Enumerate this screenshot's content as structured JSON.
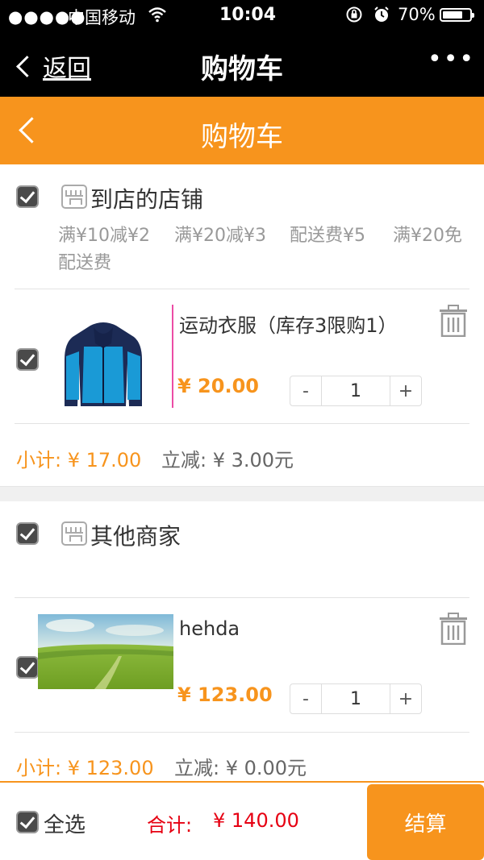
{
  "status_bar": {
    "signal": "●●●●●",
    "carrier": "中国移动",
    "wifi_icon": "wifi-icon",
    "time": "10:04",
    "battery": "70%"
  },
  "wechat_header": {
    "back_label": "返回",
    "title": "购物车",
    "more": "•••"
  },
  "app_header": {
    "title": "购物车"
  },
  "stores": [
    {
      "name": "到店的店铺",
      "promos": [
        "满¥10减¥2",
        "满¥20减¥3",
        "配送费¥5",
        "满¥20免",
        "配送费"
      ],
      "item": {
        "name": "运动衣服（库存3限购1）",
        "price": "¥ 20.00",
        "qty": "1",
        "minus": "-",
        "plus": "+"
      },
      "subtotal": "小计: ¥ 17.00",
      "discount": "立减: ¥ 3.00元"
    },
    {
      "name": "其他商家",
      "promos": [],
      "item": {
        "name": "hehda",
        "price": "¥ 123.00",
        "qty": "1",
        "minus": "-",
        "plus": "+"
      },
      "subtotal": "小计: ¥ 123.00",
      "discount": "立减: ¥ 0.00元"
    }
  ],
  "footer": {
    "select_all": "全选",
    "total_label": "合计:",
    "total_value": "¥ 140.00",
    "checkout": "结算"
  },
  "colors": {
    "accent": "#f7941d",
    "total_red": "#e60012"
  }
}
